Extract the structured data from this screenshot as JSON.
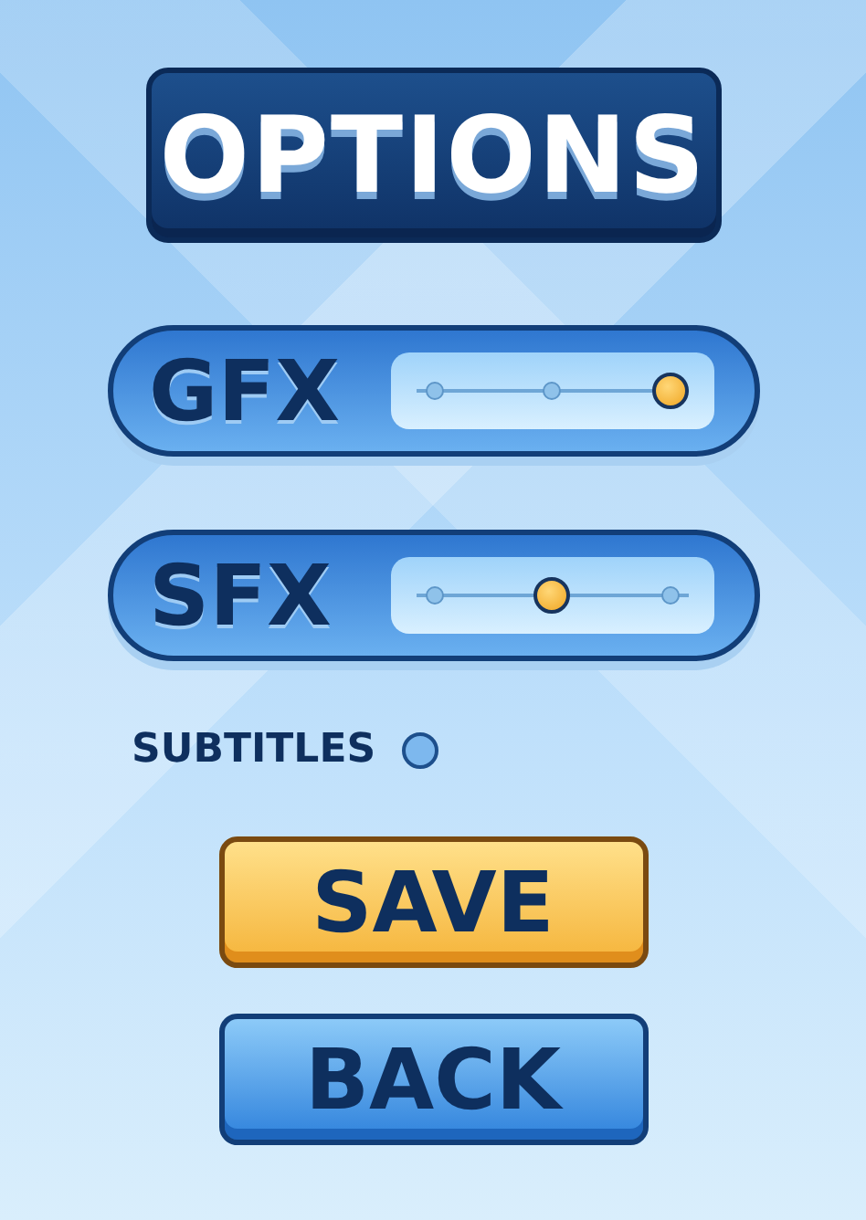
{
  "title": "OPTIONS",
  "sliders": [
    {
      "label": "GFX",
      "level": 1.0
    },
    {
      "label": "SFX",
      "level": 0.5
    }
  ],
  "subtitles": {
    "label": "SUBTITLES",
    "checked": false
  },
  "buttons": [
    {
      "label": "SAVE",
      "kind": "primary"
    },
    {
      "label": "BACK",
      "kind": "secondary"
    }
  ]
}
